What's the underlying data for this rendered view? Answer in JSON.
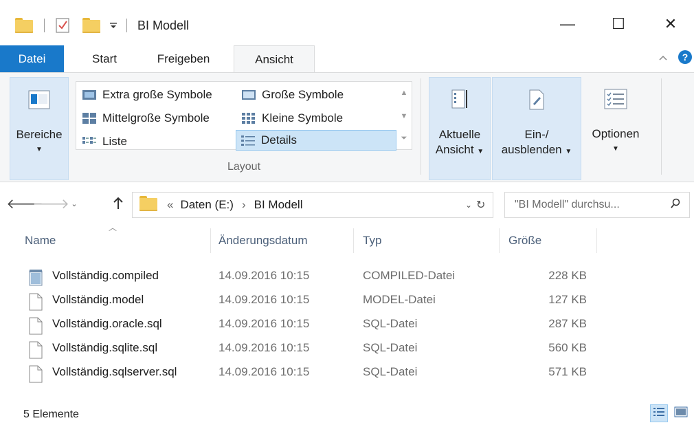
{
  "window": {
    "title": "BI Modell",
    "minimize_glyph": "—",
    "maximize_glyph": "☐",
    "close_glyph": "✕"
  },
  "ribbon_tabs": {
    "file": "Datei",
    "items": [
      "Start",
      "Freigeben",
      "Ansicht"
    ],
    "active": "Ansicht"
  },
  "ribbon": {
    "panes": "Bereiche",
    "layout_items": [
      {
        "label": "Extra große Symbole",
        "icon": "extra-large-icons-icon"
      },
      {
        "label": "Große Symbole",
        "icon": "large-icons-icon"
      },
      {
        "label": "Mittelgroße Symbole",
        "icon": "medium-icons-icon"
      },
      {
        "label": "Kleine Symbole",
        "icon": "small-icons-icon"
      },
      {
        "label": "Liste",
        "icon": "list-icon"
      },
      {
        "label": "Details",
        "icon": "details-icon",
        "selected": true
      }
    ],
    "layout_group_label": "Layout",
    "current_view": {
      "line1": "Aktuelle",
      "line2": "Ansicht"
    },
    "show_hide": {
      "line1": "Ein-/",
      "line2": "ausblenden"
    },
    "options": "Optionen"
  },
  "address": {
    "breadcrumb_prefix": "«",
    "segments": [
      "Daten (E:)",
      "BI Modell"
    ],
    "separator": "›",
    "search_placeholder": "\"BI Modell\" durchsu..."
  },
  "columns": {
    "name": "Name",
    "date": "Änderungsdatum",
    "type": "Typ",
    "size": "Größe"
  },
  "files": [
    {
      "name": "Vollständig.compiled",
      "date": "14.09.2016 10:15",
      "type": "COMPILED-Datei",
      "size": "228 KB",
      "icon": "compiled-file-icon"
    },
    {
      "name": "Vollständig.model",
      "date": "14.09.2016 10:15",
      "type": "MODEL-Datei",
      "size": "127 KB",
      "icon": "blank-file-icon"
    },
    {
      "name": "Vollständig.oracle.sql",
      "date": "14.09.2016 10:15",
      "type": "SQL-Datei",
      "size": "287 KB",
      "icon": "blank-file-icon"
    },
    {
      "name": "Vollständig.sqlite.sql",
      "date": "14.09.2016 10:15",
      "type": "SQL-Datei",
      "size": "560 KB",
      "icon": "blank-file-icon"
    },
    {
      "name": "Vollständig.sqlserver.sql",
      "date": "14.09.2016 10:15",
      "type": "SQL-Datei",
      "size": "571 KB",
      "icon": "blank-file-icon"
    }
  ],
  "status": {
    "count": "5 Elemente"
  },
  "colors": {
    "accent": "#1979ca",
    "ribbon_bg": "#f5f6f7",
    "selection": "#cce4f7",
    "header_text": "#4c607a"
  }
}
